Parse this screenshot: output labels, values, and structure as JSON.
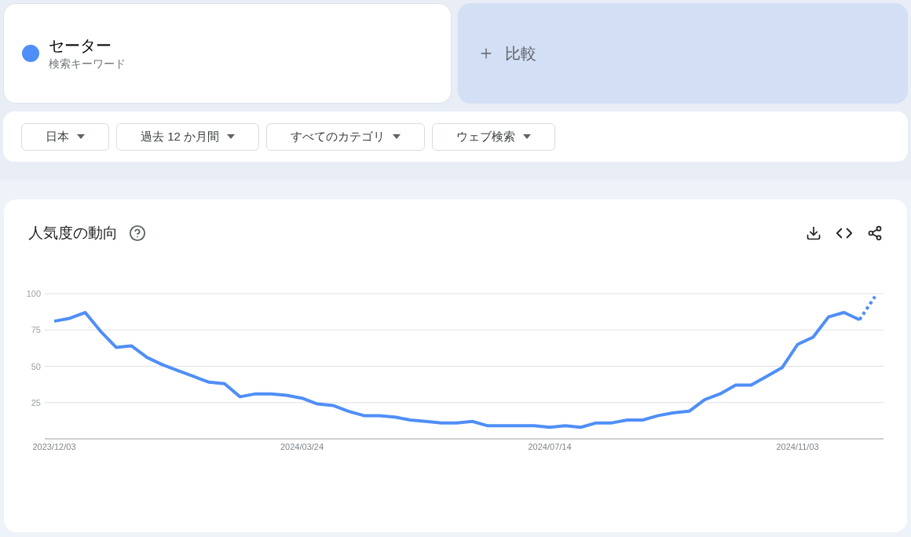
{
  "term": {
    "name": "セーター",
    "subtitle": "検索キーワード",
    "color": "#4f8ef7"
  },
  "compare": {
    "label": "比較"
  },
  "filters": [
    {
      "label": "日本"
    },
    {
      "label": "過去 12 か月間"
    },
    {
      "label": "すべてのカテゴリ"
    },
    {
      "label": "ウェブ検索"
    }
  ],
  "trend": {
    "title": "人気度の動向",
    "chart_data": {
      "type": "line",
      "categories": [
        "2023/12/03",
        null,
        null,
        null,
        null,
        null,
        null,
        null,
        null,
        null,
        null,
        null,
        null,
        null,
        null,
        null,
        "2024/03/24",
        null,
        null,
        null,
        null,
        null,
        null,
        null,
        null,
        null,
        null,
        null,
        null,
        null,
        null,
        null,
        "2024/07/14",
        null,
        null,
        null,
        null,
        null,
        null,
        null,
        null,
        null,
        null,
        null,
        null,
        null,
        null,
        null,
        "2024/11/03",
        null,
        null,
        null,
        null,
        null
      ],
      "ylim": [
        0,
        100
      ],
      "yticks": [
        25,
        50,
        75,
        100
      ],
      "grid": true,
      "series": [
        {
          "color": "#4f8ef7",
          "values": [
            81,
            83,
            87,
            74,
            63,
            64,
            56,
            51,
            47,
            43,
            39,
            38,
            29,
            31,
            31,
            30,
            28,
            24,
            23,
            19,
            16,
            16,
            15,
            13,
            12,
            11,
            11,
            12,
            9,
            9,
            9,
            9,
            8,
            9,
            8,
            11,
            11,
            13,
            13,
            16,
            18,
            19,
            27,
            31,
            37,
            37,
            43,
            49,
            65,
            70,
            84,
            87,
            82,
            98
          ]
        }
      ]
    }
  }
}
